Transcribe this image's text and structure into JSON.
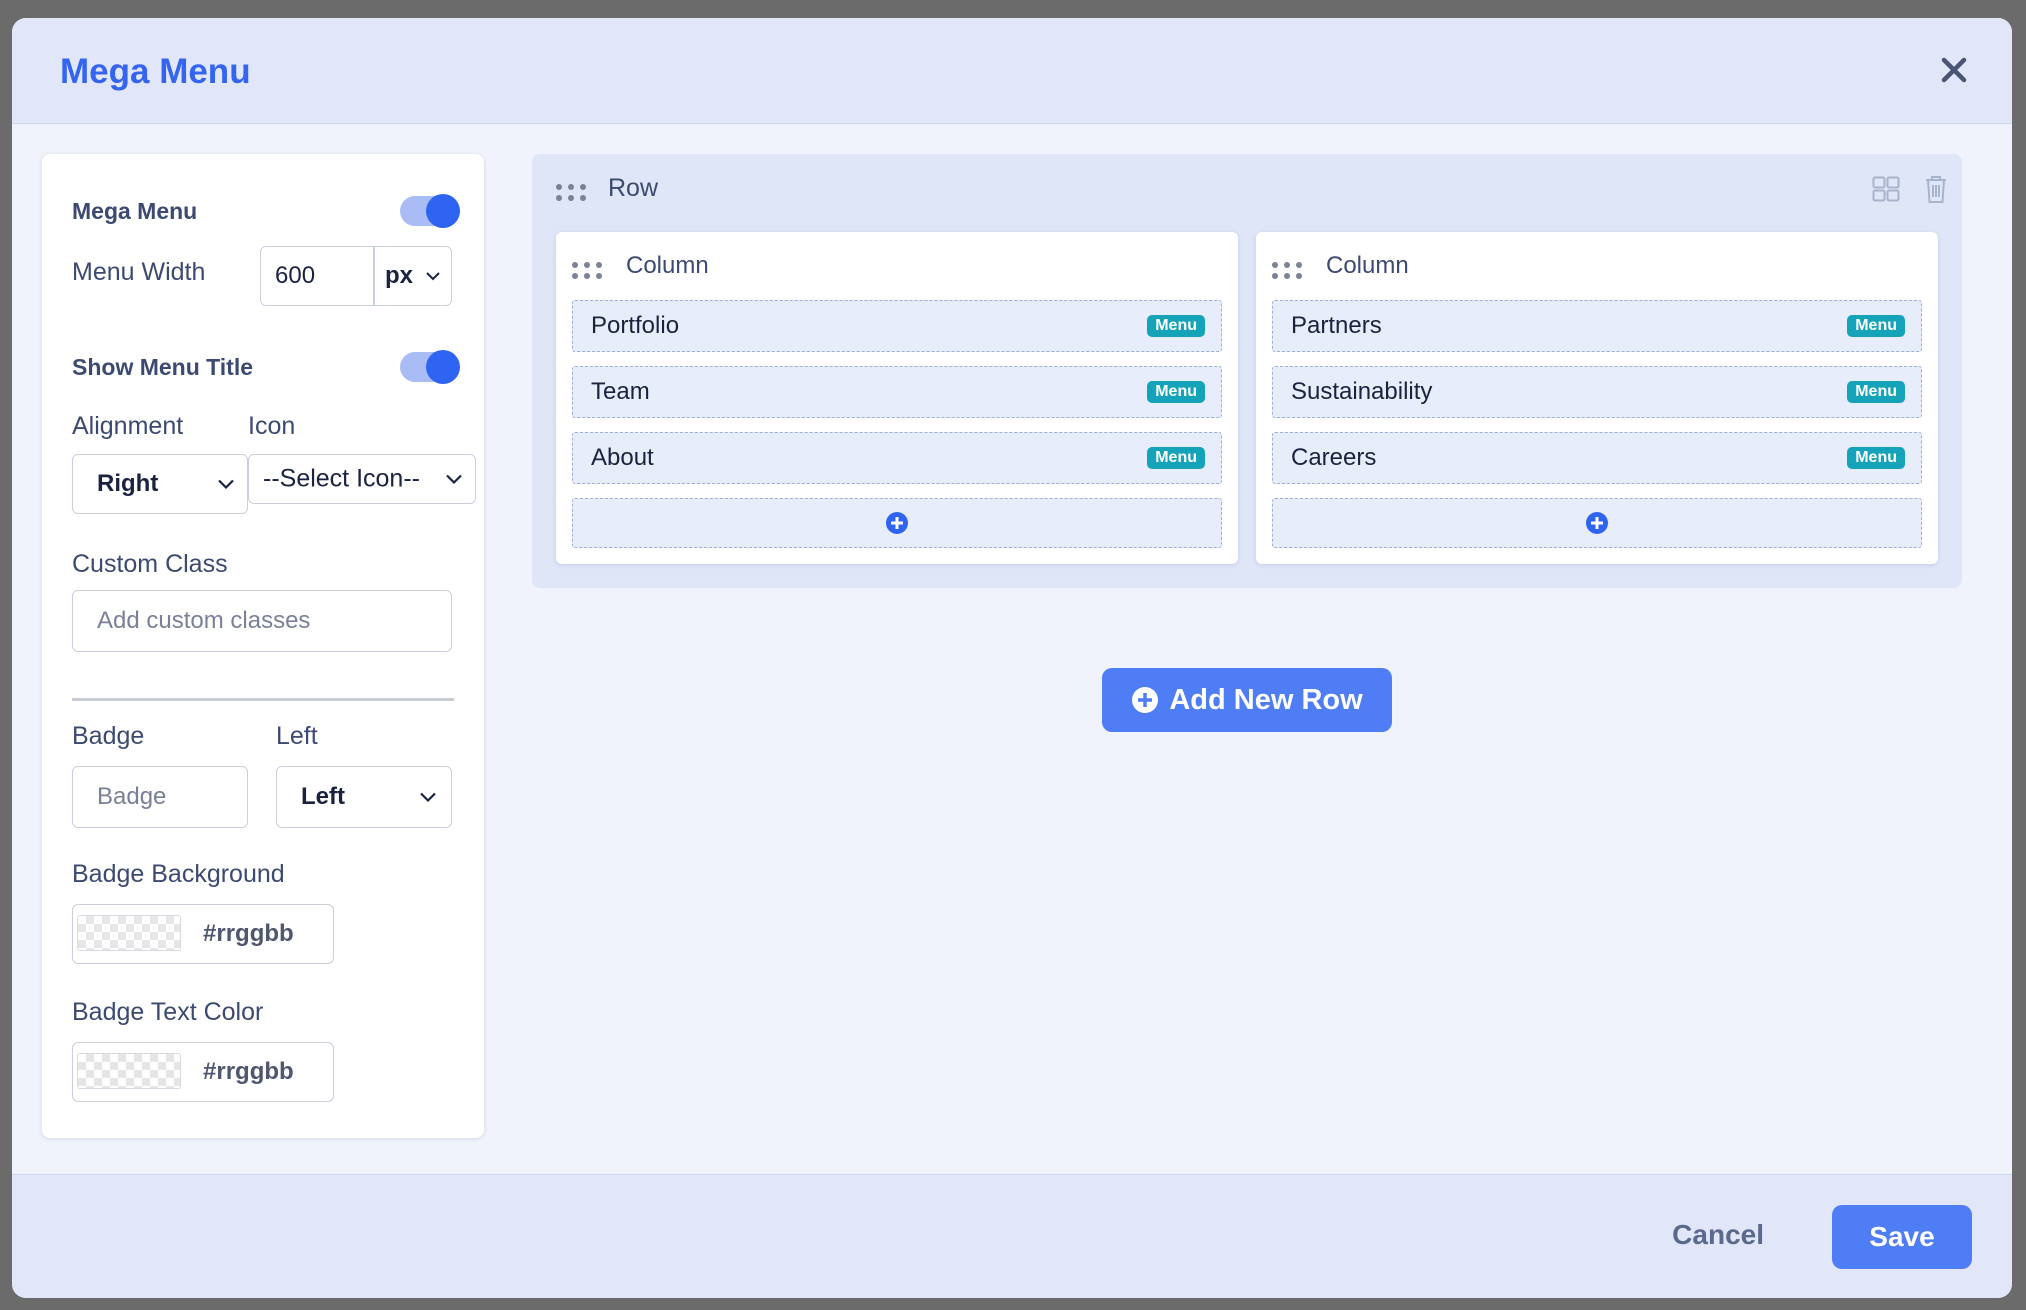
{
  "modal": {
    "title": "Mega Menu"
  },
  "settings": {
    "mega_menu_label": "Mega Menu",
    "mega_menu_enabled": true,
    "menu_width_label": "Menu Width",
    "menu_width_value": "600",
    "menu_width_unit": "px",
    "show_menu_title_label": "Show Menu Title",
    "show_menu_title_enabled": true,
    "alignment_label": "Alignment",
    "alignment_value": "Right",
    "icon_label": "Icon",
    "icon_value": "--Select Icon--",
    "custom_class_label": "Custom Class",
    "custom_class_placeholder": "Add custom classes",
    "badge_label": "Badge",
    "badge_placeholder": "Badge",
    "badge_position_label": "Left",
    "badge_position_value": "Left",
    "badge_background_label": "Badge Background",
    "badge_background_placeholder": "#rrggbb",
    "badge_text_color_label": "Badge Text Color",
    "badge_text_color_placeholder": "#rrggbb"
  },
  "builder": {
    "row_label": "Row",
    "columns": [
      {
        "label": "Column",
        "items": [
          {
            "name": "Portfolio",
            "badge": "Menu"
          },
          {
            "name": "Team",
            "badge": "Menu"
          },
          {
            "name": "About",
            "badge": "Menu"
          }
        ]
      },
      {
        "label": "Column",
        "items": [
          {
            "name": "Partners",
            "badge": "Menu"
          },
          {
            "name": "Sustainability",
            "badge": "Menu"
          },
          {
            "name": "Careers",
            "badge": "Menu"
          }
        ]
      }
    ],
    "add_row_label": "Add New Row"
  },
  "footer": {
    "cancel_label": "Cancel",
    "save_label": "Save"
  },
  "colors": {
    "accent": "#3565f0",
    "badge": "#14a3b8",
    "button": "#4f7df5"
  }
}
